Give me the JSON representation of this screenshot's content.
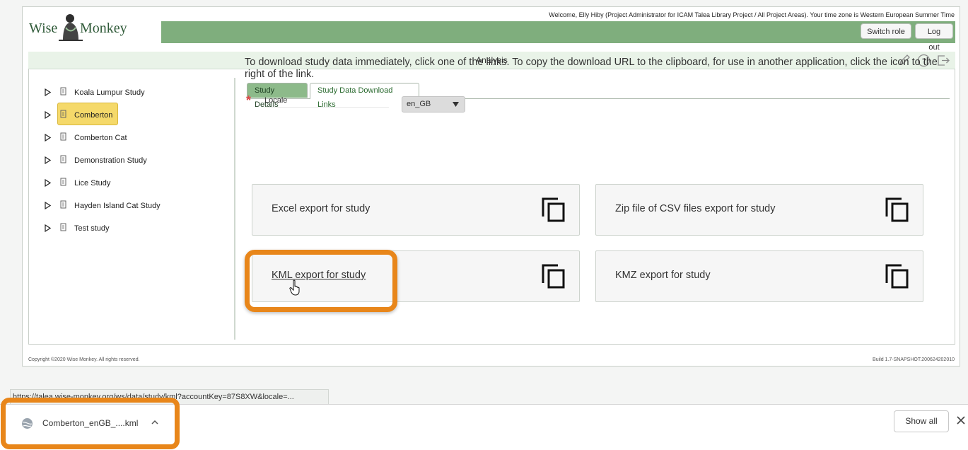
{
  "header": {
    "logo_word_1": "Wise",
    "logo_word_2": "Monkey",
    "welcome": "Welcome, Elly Hiby (Project Administrator for ICAM Talea Library Project / All Project Areas). Your time zone is Western European Summer Time",
    "switch_role": "Switch role",
    "log_out": "Log out"
  },
  "analysis_bar": {
    "title": "Analysis",
    "icons": [
      "pencil-icon",
      "help-icon",
      "exit-icon"
    ]
  },
  "sidebar": {
    "items": [
      {
        "label": "Koala Lumpur Study",
        "selected": false
      },
      {
        "label": "Comberton",
        "selected": true
      },
      {
        "label": "Comberton Cat",
        "selected": false
      },
      {
        "label": "Demonstration Study",
        "selected": false
      },
      {
        "label": "Lice Study",
        "selected": false
      },
      {
        "label": "Hayden Island Cat Study",
        "selected": false
      },
      {
        "label": "Test study",
        "selected": false
      }
    ]
  },
  "tabs": [
    {
      "label": "Study Details",
      "active": false
    },
    {
      "label": "Study Data Download Links",
      "active": true
    }
  ],
  "instructions": "To download study data immediately, click one of the links. To copy the download URL to the clipboard, for use in another application, click the icon to the right of the link.",
  "locale": {
    "label": "Locale",
    "required_marker": "*",
    "value": "en_GB"
  },
  "exports": [
    {
      "label": "Excel export for study"
    },
    {
      "label": "Zip file of CSV files export for study"
    },
    {
      "label": "KML export for study"
    },
    {
      "label": "KMZ export for study"
    }
  ],
  "footer": {
    "copyright": "Copyright ©2020 Wise Monkey. All rights reserved.",
    "build": "Build 1.7-SNAPSHOT.200624202010"
  },
  "statusbar": {
    "url": "https://talea.wise-monkey.org/ws/data/study/kml?accountKey=87S8XW&locale=..."
  },
  "download_bar": {
    "file_name": "Comberton_enGB_....kml",
    "show_all": "Show all"
  },
  "colors": {
    "green_bar": "#7fae7d",
    "highlight_orange": "#e8861a",
    "selected_yellow": "#f5d96a"
  }
}
